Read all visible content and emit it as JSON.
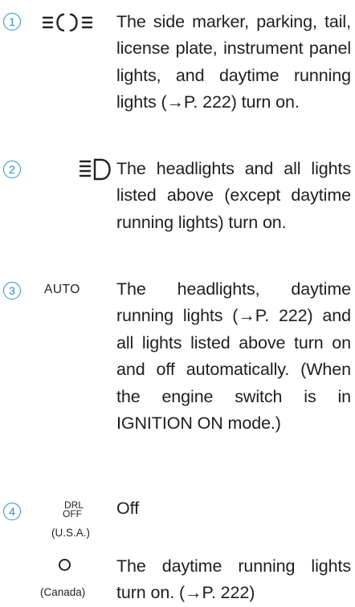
{
  "items": [
    {
      "number": "1",
      "symbol": "parking-lights-icon",
      "text": "The side marker, parking, tail, license plate, instrument panel lights, and daytime running lights (→P. 222) turn on."
    },
    {
      "number": "2",
      "symbol": "headlight-icon",
      "text": "The headlights and all lights listed above (except daytime running lights) turn on."
    },
    {
      "number": "3",
      "symbol_text": "AUTO",
      "text": "The headlights, daytime running lights (→P. 222) and all lights listed above turn on and off automatically. (When the engine switch is in IGNITION ON mode.)"
    },
    {
      "number": "4",
      "symbol_line1": "DRL",
      "symbol_line2": "OFF",
      "region": "(U.S.A.)",
      "text": "Off"
    }
  ],
  "canada": {
    "symbol": "circle-icon",
    "region": "(Canada)",
    "text": "The daytime running lights turn on. (→P. 222)"
  },
  "colors": {
    "number_accent": "#2a8fc9",
    "text": "#1e1e1e"
  }
}
